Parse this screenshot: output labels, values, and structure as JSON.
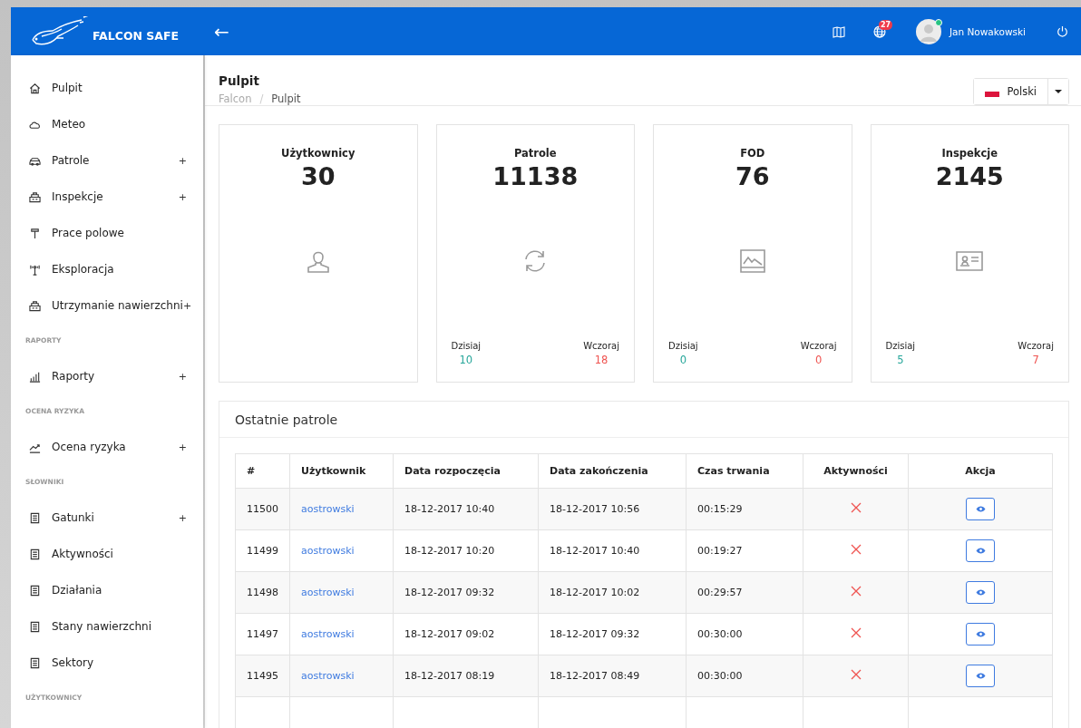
{
  "header": {
    "logo_text": "FALCON SAFE",
    "back": "←",
    "notifications_count": "27",
    "user_name": "Jan Nowakowski",
    "user_online": true
  },
  "sidebar": {
    "items": [
      {
        "kind": "item",
        "label": "Pulpit"
      },
      {
        "kind": "item",
        "label": "Meteo"
      },
      {
        "kind": "item",
        "label": "Patrole",
        "expand": "+"
      },
      {
        "kind": "item",
        "label": "Inspekcje",
        "expand": "+"
      },
      {
        "kind": "item",
        "label": "Prace polowe"
      },
      {
        "kind": "item",
        "label": "Eksploracja"
      },
      {
        "kind": "item",
        "label": "Utrzymanie nawierzchni",
        "expand": "+"
      },
      {
        "kind": "section",
        "label": "RAPORTY"
      },
      {
        "kind": "item",
        "label": "Raporty",
        "expand": "+"
      },
      {
        "kind": "section",
        "label": "OCENA RYZYKA"
      },
      {
        "kind": "item",
        "label": "Ocena ryzyka",
        "expand": "+"
      },
      {
        "kind": "section",
        "label": "SŁOWNIKI"
      },
      {
        "kind": "item",
        "label": "Gatunki",
        "expand": "+"
      },
      {
        "kind": "item",
        "label": "Aktywności"
      },
      {
        "kind": "item",
        "label": "Działania"
      },
      {
        "kind": "item",
        "label": "Stany nawierzchni"
      },
      {
        "kind": "item",
        "label": "Sektory"
      },
      {
        "kind": "section",
        "label": "UŻYTKOWNICY"
      }
    ]
  },
  "page": {
    "title": "Pulpit",
    "breadcrumb": [
      "Falcon",
      "Pulpit"
    ],
    "breadcrumb_separator": "/",
    "language": "Polski"
  },
  "stats": [
    {
      "title": "Użytkownicy",
      "value": "30"
    },
    {
      "title": "Patrole",
      "value": "11138",
      "today_label": "Dzisiaj",
      "today": "10",
      "yesterday_label": "Wczoraj",
      "yesterday": "18"
    },
    {
      "title": "FOD",
      "value": "76",
      "today_label": "Dzisiaj",
      "today": "0",
      "yesterday_label": "Wczoraj",
      "yesterday": "0"
    },
    {
      "title": "Inspekcje",
      "value": "2145",
      "today_label": "Dzisiaj",
      "today": "5",
      "yesterday_label": "Wczoraj",
      "yesterday": "7"
    }
  ],
  "recent_patrols": {
    "title": "Ostatnie patrole",
    "columns": [
      "#",
      "Użytkownik",
      "Data rozpoczęcia",
      "Data zakończenia",
      "Czas trwania",
      "Aktywności",
      "Akcja"
    ],
    "rows": [
      {
        "id": "11500",
        "user": "aostrowski",
        "start": "18-12-2017 10:40",
        "end": "18-12-2017 10:56",
        "duration": "00:15:29",
        "activities": false
      },
      {
        "id": "11499",
        "user": "aostrowski",
        "start": "18-12-2017 10:20",
        "end": "18-12-2017 10:40",
        "duration": "00:19:27",
        "activities": false
      },
      {
        "id": "11498",
        "user": "aostrowski",
        "start": "18-12-2017 09:32",
        "end": "18-12-2017 10:02",
        "duration": "00:29:57",
        "activities": false
      },
      {
        "id": "11497",
        "user": "aostrowski",
        "start": "18-12-2017 09:02",
        "end": "18-12-2017 09:32",
        "duration": "00:30:00",
        "activities": false
      },
      {
        "id": "11495",
        "user": "aostrowski",
        "start": "18-12-2017 08:19",
        "end": "18-12-2017 08:49",
        "duration": "00:30:00",
        "activities": false
      }
    ]
  }
}
